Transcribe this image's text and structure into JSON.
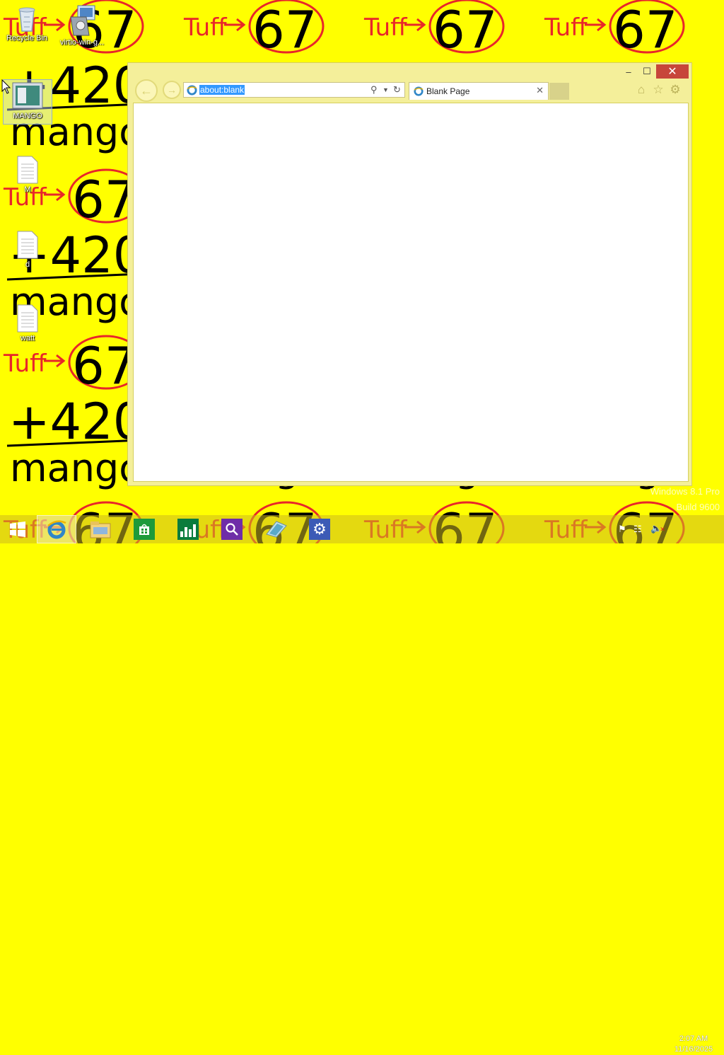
{
  "desktop": {
    "icons": [
      {
        "label": "Recycle Bin",
        "icon": "recycle-bin-icon"
      },
      {
        "label": "virtio-win-g...",
        "icon": "installer-icon"
      },
      {
        "label": "MANGO",
        "icon": "screen-image-icon"
      },
      {
        "label": "M",
        "icon": "text-file-icon"
      },
      {
        "label": "d",
        "icon": "text-file-icon"
      },
      {
        "label": "watt",
        "icon": "text-file-icon"
      }
    ],
    "wallpaper_text": {
      "word1": "Tuff",
      "num1": "67",
      "num2": "+420",
      "word2": "mango"
    }
  },
  "browser": {
    "address": "about:blank",
    "tab_title": "Blank Page",
    "caption": {
      "minimize": "–",
      "maximize": "☐",
      "close": "✕"
    },
    "toolbar_icons": [
      "home-icon",
      "favorites-star-icon",
      "settings-gear-icon"
    ]
  },
  "taskbar": {
    "apps": [
      "start-button",
      "internet-explorer-icon",
      "file-explorer-icon",
      "store-icon",
      "finance-icon",
      "search-icon",
      "tablet-icon",
      "settings-icon"
    ],
    "time": "2:07 AM",
    "date": "11/16/2025"
  },
  "watermark": {
    "line1": "Windows 8.1 Pro",
    "line2": "Build 9600"
  },
  "colors": {
    "wallpaper": "#ffff00",
    "ink_red": "#e8262a",
    "ink_black": "#000000",
    "window_frame": "#f4ef9a",
    "close_red": "#c7463a",
    "selection_blue": "#3399ff"
  }
}
